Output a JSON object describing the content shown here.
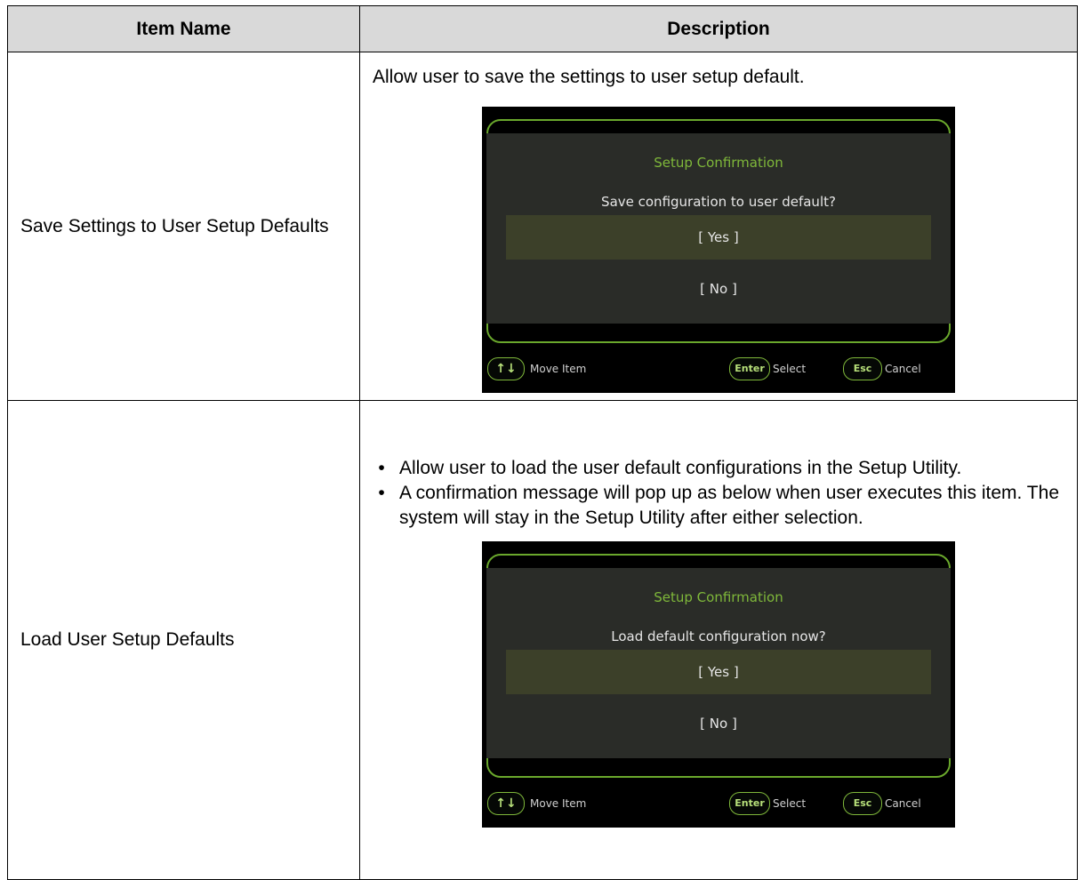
{
  "table": {
    "headers": {
      "item_name": "Item Name",
      "description": "Description"
    },
    "rows": [
      {
        "name": "Save Settings to User Setup Defaults",
        "description": "Allow user to save the settings to user setup default.",
        "dialog": {
          "title": "Setup Confirmation",
          "question": "Save configuration to user default?",
          "option_yes": "[ Yes ]",
          "option_no": "[ No ]",
          "footer": {
            "move_key": "↑↓",
            "move_label": "Move Item",
            "select_key": "Enter",
            "select_label": "Select",
            "cancel_key": "Esc",
            "cancel_label": "Cancel"
          }
        }
      },
      {
        "name": "Load User Setup Defaults",
        "bullets": [
          "Allow user to load the user default configurations in the Setup Utility.",
          "A confirmation message will pop up as below when user executes this item. The system will stay in the Setup Utility after either selection."
        ],
        "bullet_symbol": "•",
        "dialog": {
          "title": "Setup Confirmation",
          "question": "Load default configuration now?",
          "option_yes": "[ Yes ]",
          "option_no": "[ No ]",
          "footer": {
            "move_key": "↑↓",
            "move_label": "Move Item",
            "select_key": "Enter",
            "select_label": "Select",
            "cancel_key": "Esc",
            "cancel_label": "Cancel"
          }
        }
      }
    ]
  },
  "colors": {
    "header_bg": "#d9d9d9",
    "bios_accent": "#7fb83a",
    "bios_panel": "#2a2c28",
    "bios_highlight": "#3c4029"
  }
}
